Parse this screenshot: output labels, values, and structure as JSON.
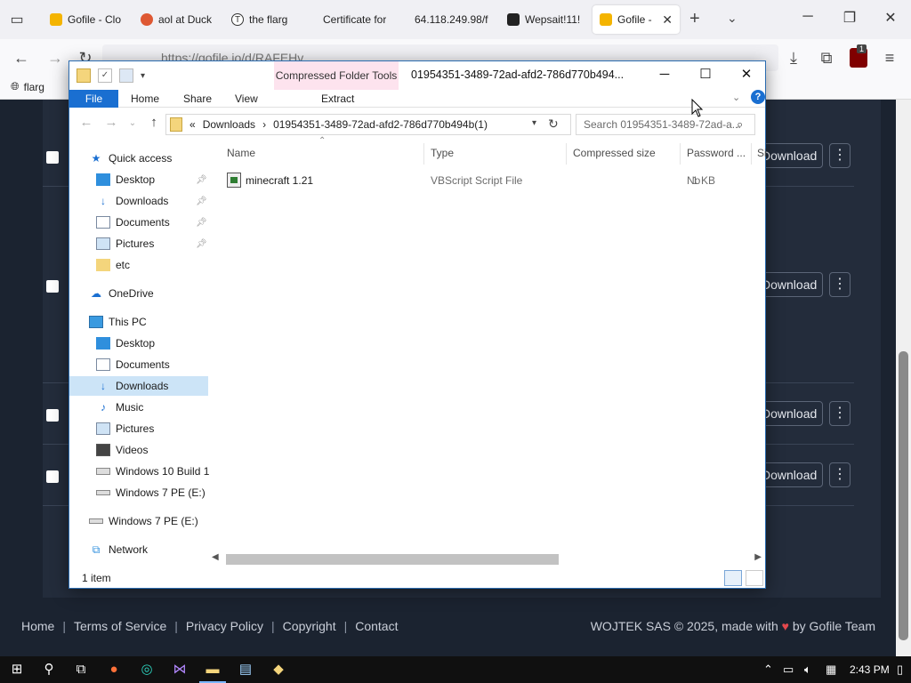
{
  "browser": {
    "tabs": [
      {
        "label": "Gofile - Clo",
        "favicon_color": "#f4b400"
      },
      {
        "label": "aol at Duck",
        "favicon_color": "#de5833"
      },
      {
        "label": "the flarg",
        "favicon_color": "#333333"
      },
      {
        "label": "Certificate for",
        "favicon_color": "#888888"
      },
      {
        "label": "64.118.249.98/f",
        "favicon_color": "#888888"
      },
      {
        "label": "Wepsait!11!",
        "favicon_color": "#222222"
      },
      {
        "label": "Gofile -",
        "favicon_color": "#f4b400",
        "active": true
      }
    ],
    "url": "https://gofile.io/d/RAFEHv",
    "bookmark": "flarg",
    "ublock_count": "1"
  },
  "site": {
    "download_label": "Download",
    "footer_links": [
      "Home",
      "Terms of Service",
      "Privacy Policy",
      "Copyright",
      "Contact"
    ],
    "footer_copy_prefix": "WOJTEK SAS © 2025, made with",
    "footer_copy_suffix": "by Gofile Team"
  },
  "explorer": {
    "context_tab": "Compressed Folder Tools",
    "title": "01954351-3489-72ad-afd2-786d770b494...",
    "ribbon": {
      "file": "File",
      "home": "Home",
      "share": "Share",
      "view": "View",
      "extract": "Extract"
    },
    "breadcrumb": {
      "prefix": "«",
      "parent": "Downloads",
      "sep": "›",
      "current": "01954351-3489-72ad-afd2-786d770b494b(1)"
    },
    "search_placeholder": "Search 01954351-3489-72ad-a...",
    "nav": {
      "quick_access": "Quick access",
      "qa_desktop": "Desktop",
      "qa_downloads": "Downloads",
      "qa_documents": "Documents",
      "qa_pictures": "Pictures",
      "qa_etc": "etc",
      "onedrive": "OneDrive",
      "this_pc": "This PC",
      "pc_desktop": "Desktop",
      "pc_documents": "Documents",
      "pc_downloads": "Downloads",
      "pc_music": "Music",
      "pc_pictures": "Pictures",
      "pc_videos": "Videos",
      "pc_win10": "Windows 10 Build 1",
      "pc_win7": "Windows 7 PE (E:)",
      "win7_root": "Windows 7 PE (E:)",
      "network": "Network"
    },
    "columns": {
      "name": "Name",
      "type": "Type",
      "compressed_size": "Compressed size",
      "password": "Password ...",
      "size": "Si"
    },
    "files": [
      {
        "name": "minecraft 1.21",
        "type": "VBScript Script File",
        "compressed_size": "1 KB",
        "password": "No"
      }
    ],
    "status": "1 item"
  },
  "taskbar": {
    "time": "2:43 PM"
  }
}
